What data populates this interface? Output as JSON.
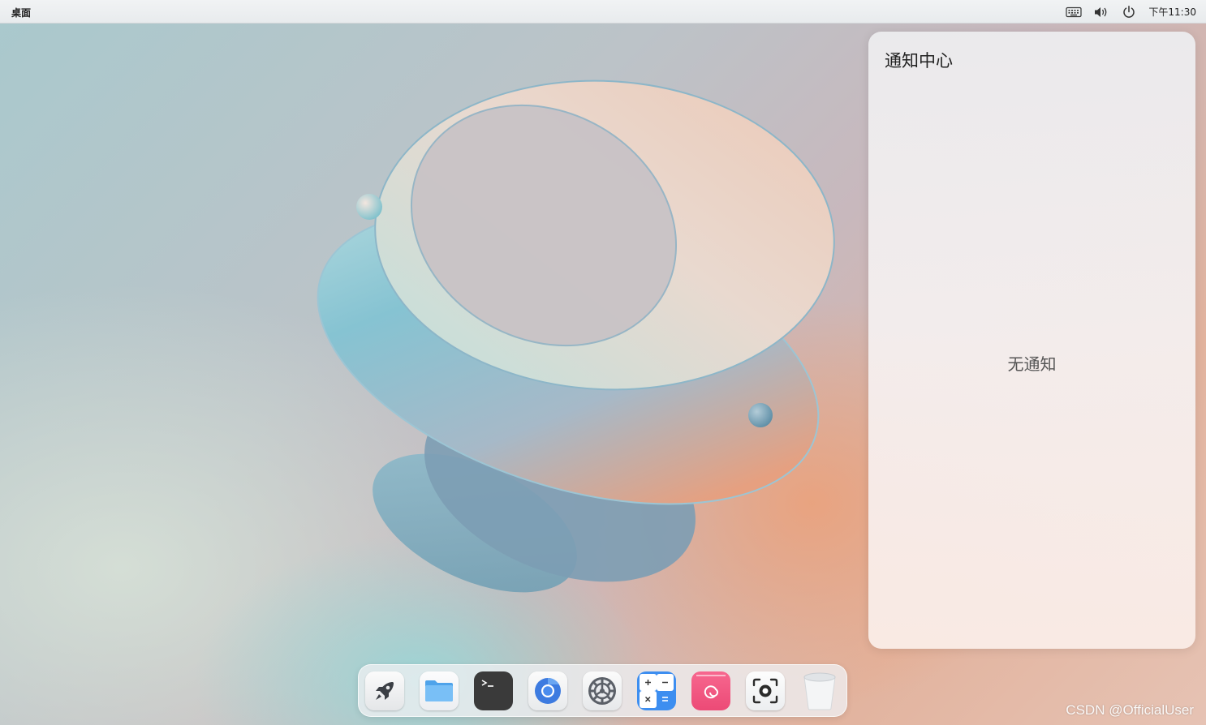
{
  "top_bar": {
    "title": "桌面",
    "tray_icons": [
      "keyboard-icon",
      "volume-icon",
      "power-icon"
    ],
    "clock": "下午11:30"
  },
  "notification_center": {
    "title": "通知中心",
    "empty_text": "无通知"
  },
  "dock": {
    "items": [
      {
        "name": "launcher",
        "icon": "rocket-icon"
      },
      {
        "name": "file-manager",
        "icon": "folder-icon"
      },
      {
        "name": "terminal",
        "icon": "terminal-icon"
      },
      {
        "name": "browser",
        "icon": "chromium-icon"
      },
      {
        "name": "settings",
        "icon": "gear-icon"
      },
      {
        "name": "calculator",
        "icon": "calculator-icon"
      },
      {
        "name": "debian-app",
        "icon": "debian-swirl-icon"
      },
      {
        "name": "screenshot",
        "icon": "screenshot-icon"
      },
      {
        "name": "trash",
        "icon": "trash-icon"
      }
    ]
  },
  "watermark": "CSDN @OfficialUser",
  "colors": {
    "accent_blue": "#3d8ef0",
    "terminal_dark": "#3a3a3a",
    "debian_pink": "#f0527e"
  }
}
